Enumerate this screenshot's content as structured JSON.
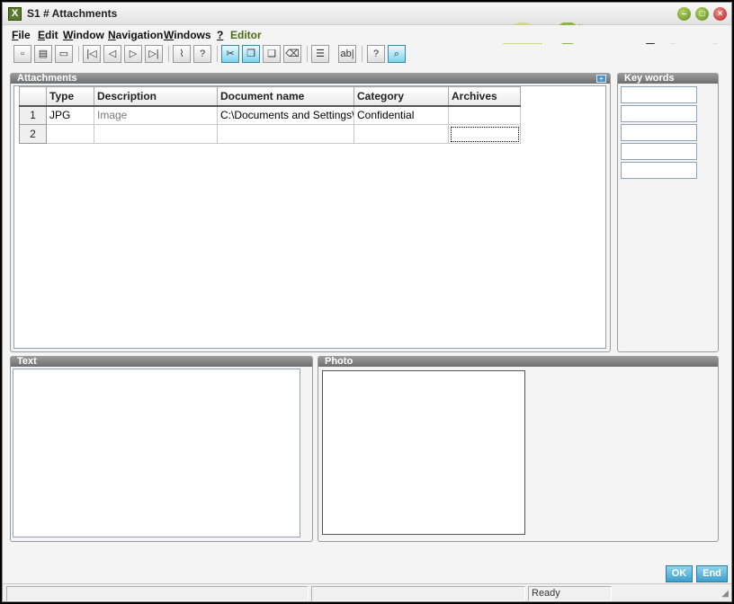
{
  "window": {
    "title": "S1 # Attachments",
    "app_icon": "xl-app-icon"
  },
  "menu": [
    {
      "label": "File",
      "underline": "F",
      "rest": "ile"
    },
    {
      "label": "Edit",
      "underline": "E",
      "rest": "dit"
    },
    {
      "label": "Window",
      "underline": "W",
      "rest": "indow"
    },
    {
      "label": "Navigation",
      "underline": "N",
      "rest": "avigation"
    },
    {
      "label": "Windows",
      "underline": "W",
      "rest": "indows"
    },
    {
      "label": "?",
      "underline": "?",
      "rest": ""
    },
    {
      "label": "Editor",
      "underline": "",
      "rest": "Editor"
    }
  ],
  "attachments": {
    "title": "Attachments",
    "columns": [
      "Type",
      "Description",
      "Document name",
      "Category",
      "Archives"
    ],
    "rows": [
      {
        "num": "1",
        "type": "JPG",
        "description": "Image",
        "document_name": "C:\\Documents and Settings\\Ac",
        "category": "Confidential",
        "archives": ""
      },
      {
        "num": "2",
        "type": "",
        "description": "",
        "document_name": "",
        "category": "",
        "archives": ""
      }
    ]
  },
  "keywords": {
    "title": "Key words",
    "values": [
      "",
      "",
      "",
      "",
      ""
    ]
  },
  "text_panel": {
    "title": "Text",
    "value": ""
  },
  "photo_panel": {
    "title": "Photo"
  },
  "buttons": {
    "ok": "OK",
    "end": "End"
  },
  "status": {
    "cell1": "",
    "cell2": "",
    "cell3": "Ready"
  },
  "colors": {
    "accent": "#3d9fcc",
    "panel_header": "#7a7a7a",
    "brand_green": "#5d8a1a"
  }
}
